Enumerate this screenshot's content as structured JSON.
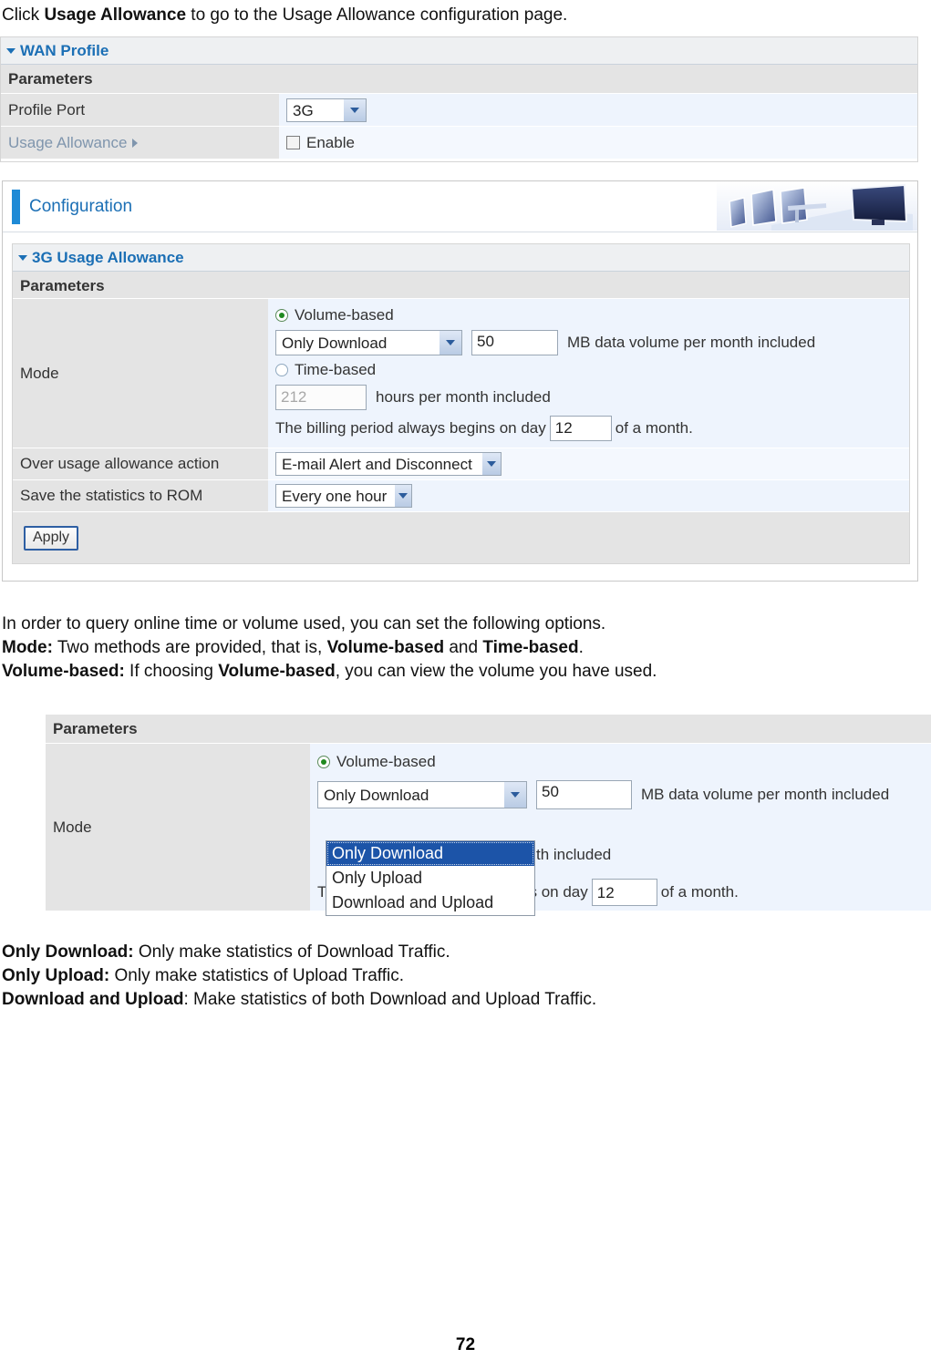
{
  "intro": {
    "before": "Click ",
    "bold": "Usage Allowance",
    "after": " to go to the Usage Allowance configuration page."
  },
  "wan_profile_panel": {
    "section_title": "WAN Profile",
    "params_header": "Parameters",
    "rows": [
      {
        "label": "Profile Port",
        "control": "select",
        "value": "3G"
      },
      {
        "label": "Usage Allowance",
        "control": "checkbox",
        "value": "Enable"
      }
    ]
  },
  "configuration_panel": {
    "header_title": "Configuration",
    "section_title": "3G Usage Allowance",
    "params_header": "Parameters",
    "mode_label": "Mode",
    "volume_based_label": "Volume-based",
    "volume_select_value": "Only Download",
    "volume_amount": "50",
    "volume_suffix": "MB data volume per month included",
    "time_based_label": "Time-based",
    "hours_value": "212",
    "hours_suffix": "hours per month included",
    "billing_prefix": "The billing period always begins on day",
    "billing_day": "12",
    "billing_suffix": "of a month.",
    "over_usage_label": "Over usage allowance action",
    "over_usage_value": "E-mail Alert and Disconnect",
    "save_rom_label": "Save the statistics to ROM",
    "save_rom_value": "Every one hour",
    "apply_label": "Apply"
  },
  "middle_text": {
    "line1": "In order to query online time or volume used, you can set the following options.",
    "line2_bold": "Mode:",
    "line2_a": " Two methods are provided, that is, ",
    "line2_b1": "Volume-based",
    "line2_b": " and ",
    "line2_b2": "Time-based",
    "line2_c": ".",
    "line3_bold": "Volume-based:",
    "line3_a": " If choosing ",
    "line3_b1": "Volume-based",
    "line3_c": ", you can view the volume you have used."
  },
  "dropdown_panel": {
    "params_header": "Parameters",
    "mode_label": "Mode",
    "volume_based_label": "Volume-based",
    "select_value": "Only Download",
    "volume_amount": "50",
    "volume_suffix": "MB data volume per month included",
    "options": [
      "Only Download",
      "Only Upload",
      "Download and Upload"
    ],
    "selected_option": "Only Download",
    "hidden_suffix": "th included",
    "billing_prefix": "The billing period always begins on day",
    "billing_day": "12",
    "billing_suffix": "of a month."
  },
  "bottom_text": {
    "line1_bold": "Only Download:",
    "line1_rest": " Only make statistics of Download Traffic.",
    "line2_bold": "Only Upload:",
    "line2_rest": " Only make statistics of Upload Traffic.",
    "line3_bold": "Download and Upload",
    "line3_rest": ": Make statistics of both Download and Upload Traffic."
  },
  "footer": {
    "page_number": "72"
  },
  "colors": {
    "accent_blue": "#1b6fb5",
    "banner_blue": "#1e8ad6",
    "row_label_gray": "#e4e4e4",
    "row_value_blue": "#eef4fd",
    "select_highlight": "#1c54a8",
    "link_gray_blue": "#7f95ad"
  }
}
